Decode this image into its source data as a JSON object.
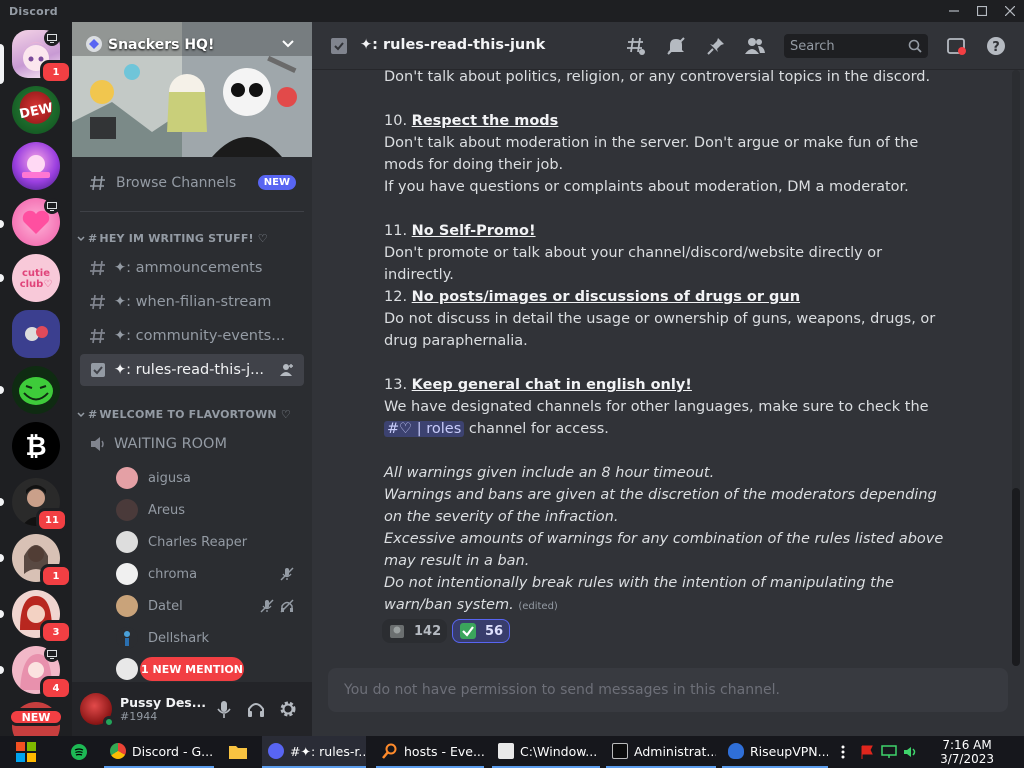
{
  "app": {
    "name": "Discord"
  },
  "colors": {
    "brand": "#5865f2",
    "danger": "#f23f43",
    "background": "#313338",
    "sidebar": "#2b2d31",
    "guild_bar": "#1e1f22"
  },
  "guilds": [
    {
      "name": "anime-avatar-server",
      "badge": "1",
      "icon": "monitor-icon"
    },
    {
      "name": "mountain-dew-server"
    },
    {
      "name": "kitten-paradise-server"
    },
    {
      "name": "pink-heart-server"
    },
    {
      "name": "cutie-club-server"
    },
    {
      "name": "snackers-hq-server"
    },
    {
      "name": "trollface-server"
    },
    {
      "name": "bitcoin-server"
    },
    {
      "name": "dark-avatar-server",
      "badge": "11"
    },
    {
      "name": "portrait-server",
      "badge": "1"
    },
    {
      "name": "redhead-server",
      "badge": "3"
    },
    {
      "name": "pink-girl-server",
      "badge": "4"
    },
    {
      "name": "new-server",
      "tag": "NEW"
    }
  ],
  "server": {
    "name": "Snackers HQ!"
  },
  "browse": {
    "label": "Browse Channels",
    "tag": "NEW"
  },
  "categories": [
    {
      "label": "HEY IM WRITING STUFF! ♡"
    },
    {
      "label": "WELCOME TO FLAVORTOWN ♡"
    }
  ],
  "channels": [
    {
      "name": "✦: ammouncements"
    },
    {
      "name": "✦: when-filian-stream"
    },
    {
      "name": "✦: community-events..."
    },
    {
      "name": "✦: rules-read-this-j..."
    }
  ],
  "voice": {
    "channel": "WAITING ROOM",
    "users": [
      "aigusa",
      "Areus",
      "Charles Reaper",
      "chroma",
      "Datel",
      "Dellshark"
    ]
  },
  "new_mention": "1 NEW MENTION",
  "user": {
    "name": "Pussy Des...",
    "tag": "#1944"
  },
  "header": {
    "channel": "✦: rules-read-this-junk",
    "search_placeholder": "Search"
  },
  "messages": {
    "top": "Don't talk about politics, religion, or any controversial topics in the discord.",
    "r10_num": "10.",
    "r10_title": "Respect the mods",
    "r10_line1": "Don't talk about moderation in the server. Don't argue or make fun of the mods for doing their job.",
    "r10_line2": "If you have questions or complaints about moderation, DM a moderator.",
    "r11_num": "11.",
    "r11_title": "No Self-Promo!",
    "r11_line1": "Don't promote or talk about your channel/discord/website directly or indirectly.",
    "r12_num": "12.",
    "r12_title": "No posts/images or discussions of drugs or gun",
    "r12_line1": "Do not discuss in detail the usage or ownership of guns, weapons, drugs, or drug paraphernalia.",
    "r13_num": "13.",
    "r13_title": "Keep general chat in english only!",
    "r13_line1": "We have designated channels for other languages, make sure to check the",
    "r13_mention": "#♡ | roles",
    "r13_line2": "channel for access.",
    "note1": "All warnings given include an 8 hour timeout.",
    "note2": "Warnings and bans are given at the discretion of the moderators depending on the severity of the infraction.",
    "note3": "Excessive amounts of warnings for any combination of the rules listed above may result in a ban.",
    "note4": "Do not intentionally break rules with the intention of manipulating the warn/ban system.",
    "edited": "(edited)"
  },
  "reactions": [
    {
      "emoji": "custom-emoji",
      "count": "142"
    },
    {
      "emoji": "white-check-mark",
      "count": "56"
    }
  ],
  "composer": {
    "placeholder": "You do not have permission to send messages in this channel."
  },
  "taskbar": {
    "items": [
      {
        "label": "Discord - G..."
      },
      {
        "label": ""
      },
      {
        "label": "#✦: rules-r..."
      },
      {
        "label": "hosts - Eve..."
      },
      {
        "label": "C:\\Window..."
      },
      {
        "label": "Administrat..."
      },
      {
        "label": "RiseupVPN..."
      }
    ],
    "time": "7:16 AM",
    "date": "3/7/2023"
  }
}
